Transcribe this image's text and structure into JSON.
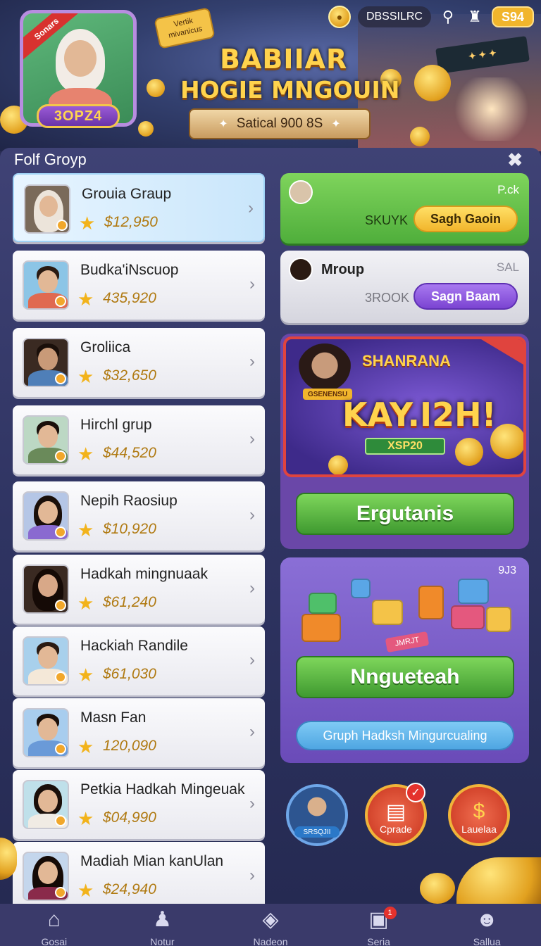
{
  "header": {
    "avatar_ribbon": "Sonars",
    "avatar_badge": "3OPZ4",
    "tag_note": "Vertik mivanicus",
    "title_line1": "BABIIAR",
    "title_line2": "HOGIE MNGOUIN",
    "banner_text": "Satical 900 8S",
    "top_bar": {
      "coin_label": "DBSSILRC",
      "gold_value": "S94"
    }
  },
  "panel": {
    "title": "Folf Groyp",
    "rows": [
      {
        "name": "Grouia Graup",
        "amount": "$12,950",
        "active": true
      },
      {
        "name": "Budka'iNscuop",
        "amount": "435,920"
      },
      {
        "name": "Groliica",
        "amount": "$32,650"
      },
      {
        "name": "Hirchl grup",
        "amount": "$44,520"
      },
      {
        "name": "Nepih Raosiup",
        "amount": "$10,920"
      },
      {
        "name": "Hadkah mingnuaak",
        "amount": "$61,240"
      },
      {
        "name": "Hackiah Randile",
        "amount": "$61,030"
      },
      {
        "name": "Masn Fan",
        "amount": "120,090"
      },
      {
        "name": "Petkia Hadkah Mingeuak",
        "amount": "$04,990"
      },
      {
        "name": "Madiah Mian kanUlan",
        "amount": "$24,940"
      }
    ]
  },
  "right": {
    "green_card": {
      "corner": "P.ck",
      "sub": "SKUYK",
      "button": "Sagh Gaoin"
    },
    "grey_card": {
      "name": "Mroup",
      "corner": "SAL",
      "sub": "3ROOK",
      "button": "Sagn Baam"
    },
    "promo": {
      "title": "SHANRANA",
      "big_text": "KAY.I2H!",
      "code": "XSP20",
      "girl_tag": "GSENENSU",
      "button": "Ergutanis"
    },
    "puzzle": {
      "corner": "9J3",
      "block_label": "JMRJT",
      "button": "Nngueteah",
      "pill": "Gruph Hadksh Mingurcualing"
    },
    "circles": [
      {
        "label": "SRSQJII",
        "icon": "avatar-icon"
      },
      {
        "label": "Cprade",
        "icon": "document-icon"
      },
      {
        "label": "Lauelaa",
        "icon": "coin-icon"
      }
    ]
  },
  "nav": [
    {
      "label": "Gosai",
      "icon": "home-icon"
    },
    {
      "label": "Notur",
      "icon": "user-icon"
    },
    {
      "label": "Nadeon",
      "icon": "cube-icon"
    },
    {
      "label": "Seria",
      "icon": "chart-icon",
      "badge": "1"
    },
    {
      "label": "Sallua",
      "icon": "profile-icon"
    }
  ],
  "colors": {
    "panel_bg": "#2f3462",
    "accent_green": "#4fae3b",
    "accent_gold": "#f1b52c",
    "accent_purple": "#7b44d2"
  }
}
